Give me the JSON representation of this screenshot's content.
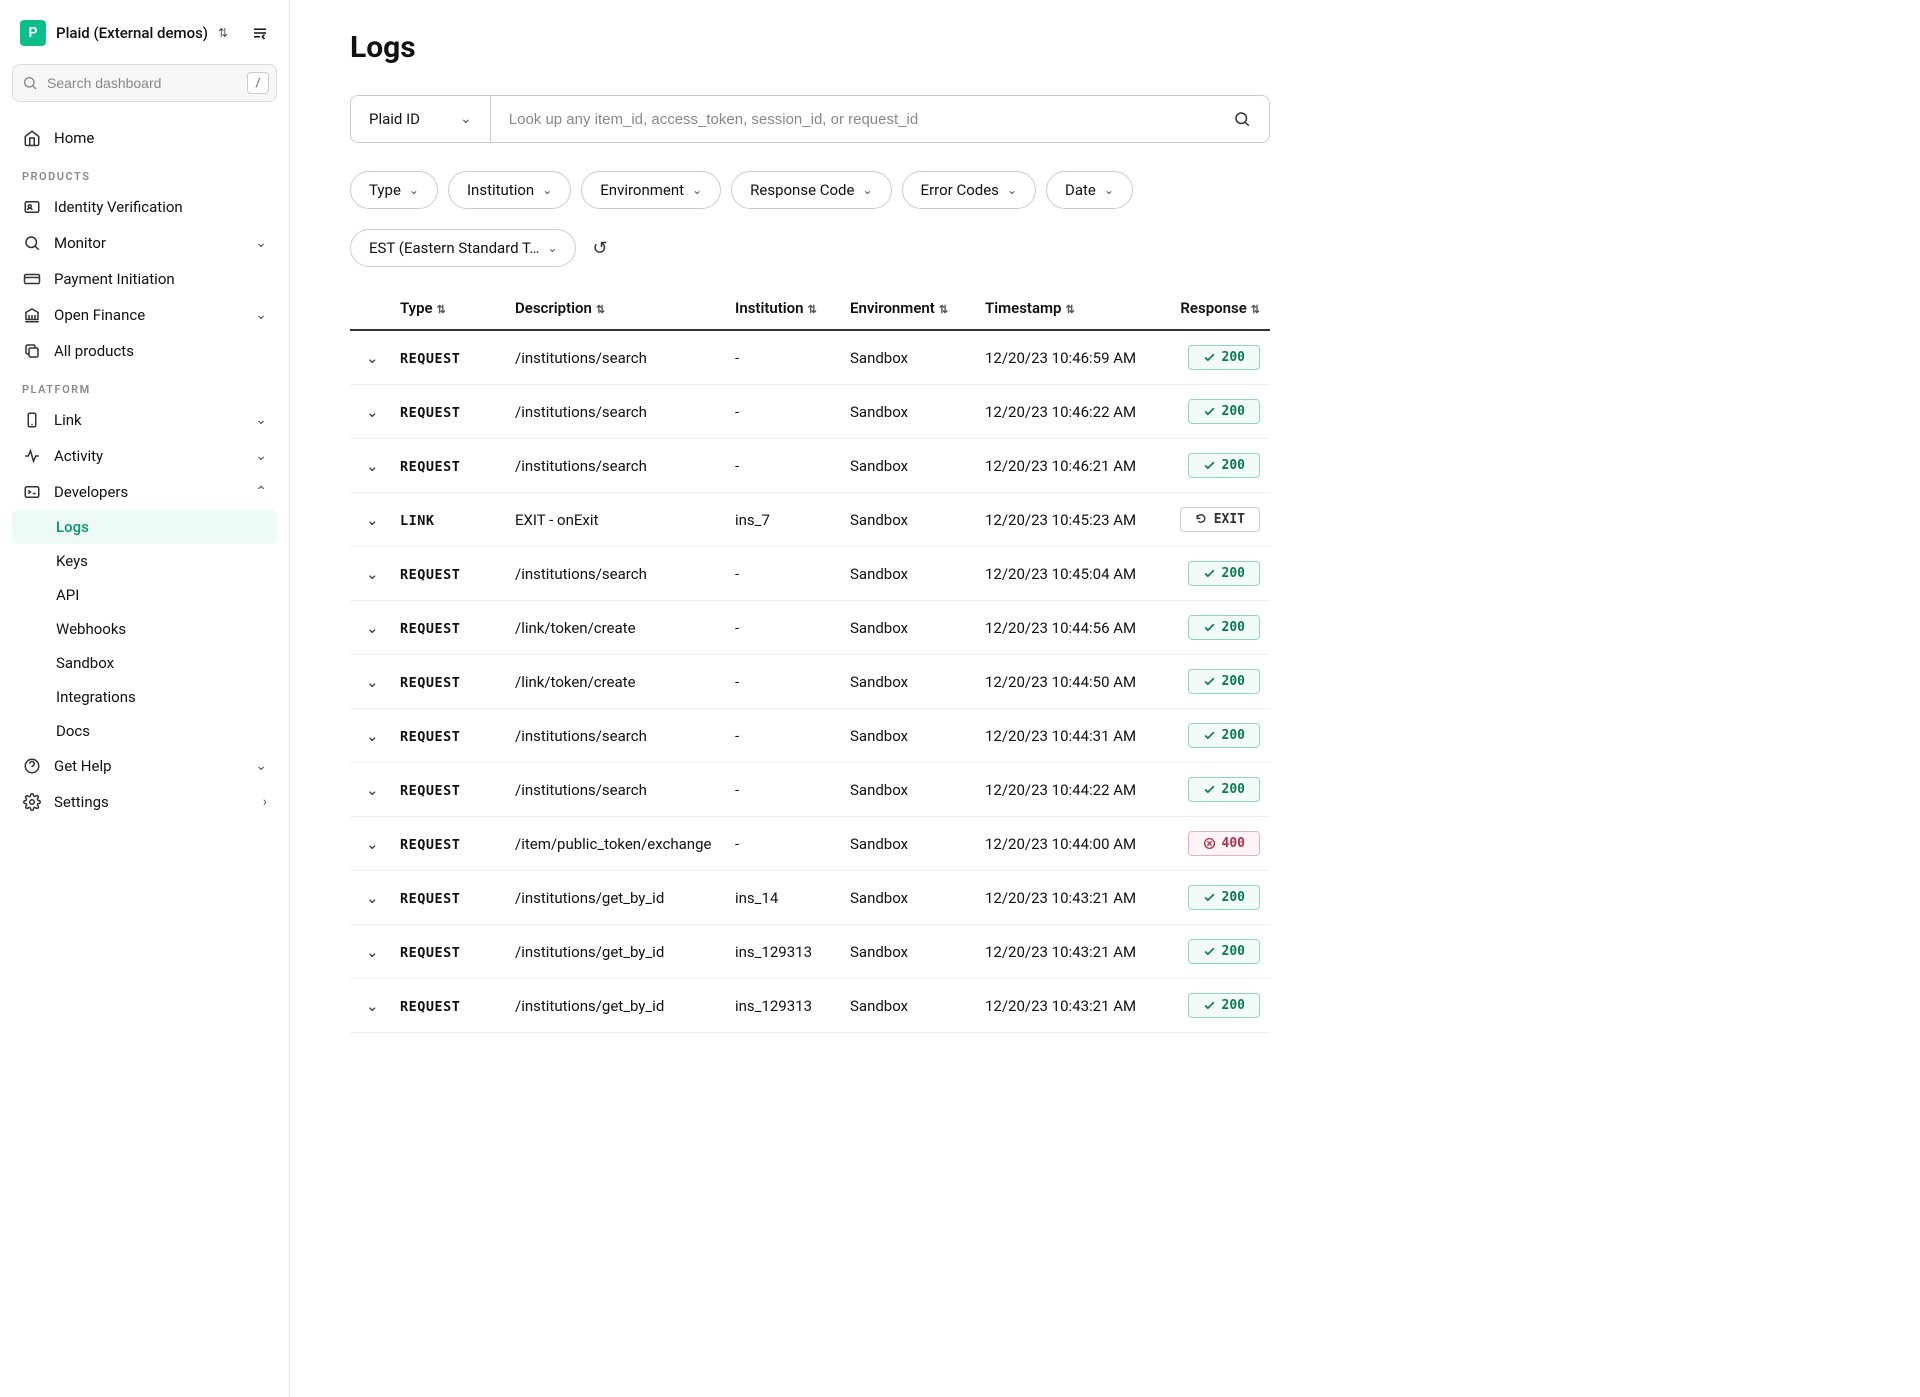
{
  "org": {
    "badge": "P",
    "name": "Plaid (External demos)"
  },
  "search": {
    "placeholder": "Search dashboard",
    "shortcut": "/"
  },
  "nav": {
    "home": "Home",
    "products_label": "PRODUCTS",
    "products": {
      "idv": "Identity Verification",
      "monitor": "Monitor",
      "payment": "Payment Initiation",
      "openfin": "Open Finance",
      "all": "All products"
    },
    "platform_label": "PLATFORM",
    "platform": {
      "link": "Link",
      "activity": "Activity",
      "developers": "Developers"
    },
    "dev_sub": {
      "logs": "Logs",
      "keys": "Keys",
      "api": "API",
      "webhooks": "Webhooks",
      "sandbox": "Sandbox",
      "integrations": "Integrations",
      "docs": "Docs"
    },
    "help": "Get Help",
    "settings": "Settings"
  },
  "page": {
    "title": "Logs"
  },
  "lookup": {
    "selector": "Plaid ID",
    "placeholder": "Look up any item_id, access_token, session_id, or request_id"
  },
  "filters": {
    "type": "Type",
    "institution": "Institution",
    "environment": "Environment",
    "response_code": "Response Code",
    "error_codes": "Error Codes",
    "date": "Date",
    "timezone": "EST (Eastern Standard T…"
  },
  "columns": {
    "type": "Type",
    "description": "Description",
    "institution": "Institution",
    "environment": "Environment",
    "timestamp": "Timestamp",
    "response": "Response"
  },
  "rows": [
    {
      "type": "REQUEST",
      "desc": "/institutions/search",
      "inst": "-",
      "env": "Sandbox",
      "ts": "12/20/23 10:46:59 AM",
      "resp": "200",
      "kind": "ok"
    },
    {
      "type": "REQUEST",
      "desc": "/institutions/search",
      "inst": "-",
      "env": "Sandbox",
      "ts": "12/20/23 10:46:22 AM",
      "resp": "200",
      "kind": "ok"
    },
    {
      "type": "REQUEST",
      "desc": "/institutions/search",
      "inst": "-",
      "env": "Sandbox",
      "ts": "12/20/23 10:46:21 AM",
      "resp": "200",
      "kind": "ok"
    },
    {
      "type": "LINK",
      "desc": "EXIT - onExit",
      "inst": "ins_7",
      "env": "Sandbox",
      "ts": "12/20/23 10:45:23 AM",
      "resp": "EXIT",
      "kind": "exit"
    },
    {
      "type": "REQUEST",
      "desc": "/institutions/search",
      "inst": "-",
      "env": "Sandbox",
      "ts": "12/20/23 10:45:04 AM",
      "resp": "200",
      "kind": "ok"
    },
    {
      "type": "REQUEST",
      "desc": "/link/token/create",
      "inst": "-",
      "env": "Sandbox",
      "ts": "12/20/23 10:44:56 AM",
      "resp": "200",
      "kind": "ok"
    },
    {
      "type": "REQUEST",
      "desc": "/link/token/create",
      "inst": "-",
      "env": "Sandbox",
      "ts": "12/20/23 10:44:50 AM",
      "resp": "200",
      "kind": "ok"
    },
    {
      "type": "REQUEST",
      "desc": "/institutions/search",
      "inst": "-",
      "env": "Sandbox",
      "ts": "12/20/23 10:44:31 AM",
      "resp": "200",
      "kind": "ok"
    },
    {
      "type": "REQUEST",
      "desc": "/institutions/search",
      "inst": "-",
      "env": "Sandbox",
      "ts": "12/20/23 10:44:22 AM",
      "resp": "200",
      "kind": "ok"
    },
    {
      "type": "REQUEST",
      "desc": "/item/public_token/exchange",
      "inst": "-",
      "env": "Sandbox",
      "ts": "12/20/23 10:44:00 AM",
      "resp": "400",
      "kind": "err"
    },
    {
      "type": "REQUEST",
      "desc": "/institutions/get_by_id",
      "inst": "ins_14",
      "env": "Sandbox",
      "ts": "12/20/23 10:43:21 AM",
      "resp": "200",
      "kind": "ok"
    },
    {
      "type": "REQUEST",
      "desc": "/institutions/get_by_id",
      "inst": "ins_129313",
      "env": "Sandbox",
      "ts": "12/20/23 10:43:21 AM",
      "resp": "200",
      "kind": "ok"
    },
    {
      "type": "REQUEST",
      "desc": "/institutions/get_by_id",
      "inst": "ins_129313",
      "env": "Sandbox",
      "ts": "12/20/23 10:43:21 AM",
      "resp": "200",
      "kind": "ok"
    }
  ]
}
